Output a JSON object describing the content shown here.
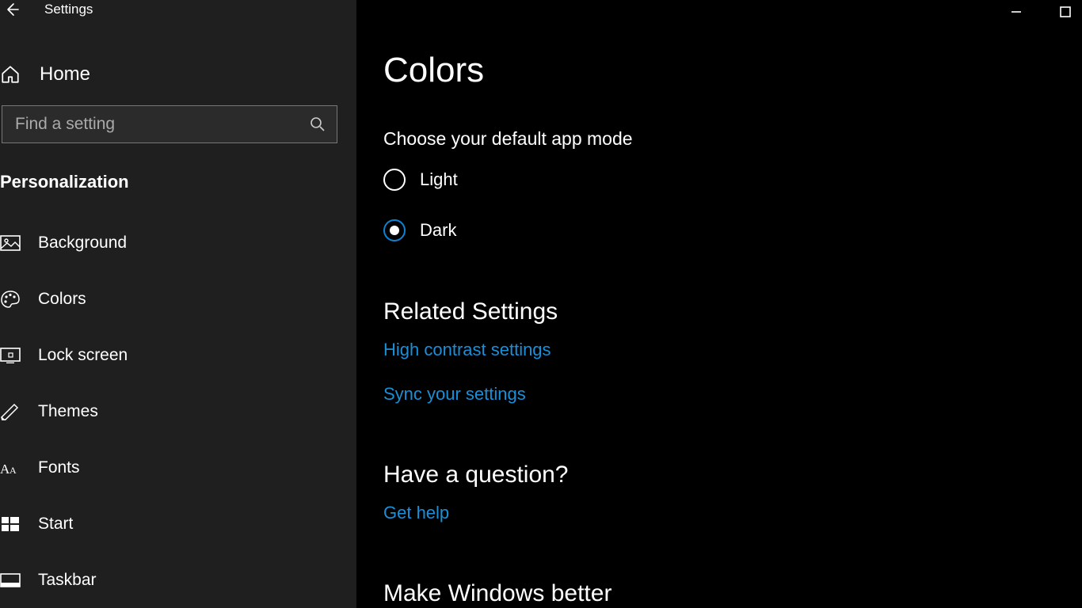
{
  "window": {
    "title": "Settings"
  },
  "sidebar": {
    "home_label": "Home",
    "search_placeholder": "Find a setting",
    "section_heading": "Personalization",
    "items": [
      {
        "label": "Background"
      },
      {
        "label": "Colors"
      },
      {
        "label": "Lock screen"
      },
      {
        "label": "Themes"
      },
      {
        "label": "Fonts"
      },
      {
        "label": "Start"
      },
      {
        "label": "Taskbar"
      }
    ]
  },
  "main": {
    "page_title": "Colors",
    "app_mode": {
      "heading": "Choose your default app mode",
      "options": [
        {
          "label": "Light",
          "selected": false
        },
        {
          "label": "Dark",
          "selected": true
        }
      ]
    },
    "related": {
      "heading": "Related Settings",
      "links": [
        "High contrast settings",
        "Sync your settings"
      ]
    },
    "question": {
      "heading": "Have a question?",
      "link": "Get help"
    },
    "better": {
      "heading": "Make Windows better"
    }
  },
  "colors": {
    "accent": "#1a8fd8"
  }
}
